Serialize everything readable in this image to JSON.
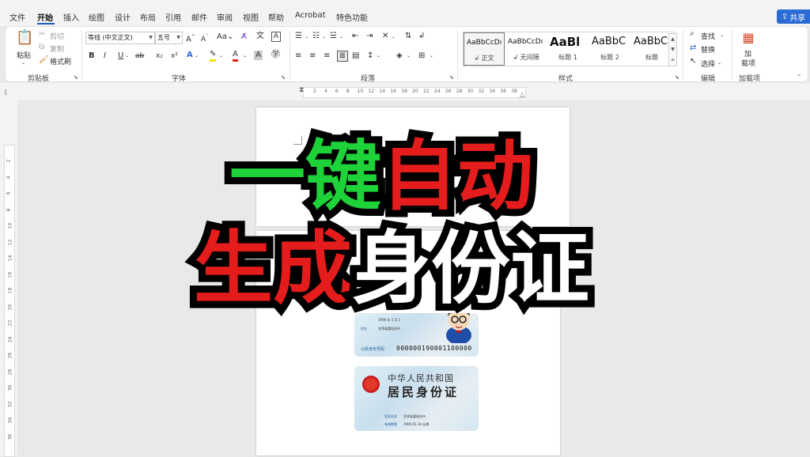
{
  "menu": {
    "tabs": [
      "文件",
      "开始",
      "插入",
      "绘图",
      "设计",
      "布局",
      "引用",
      "邮件",
      "审阅",
      "视图",
      "帮助",
      "Acrobat",
      "特色功能"
    ],
    "active_tab": "开始",
    "share_label": "共享"
  },
  "ribbon": {
    "clipboard": {
      "paste_label": "粘贴",
      "cut_label": "剪切",
      "copy_label": "复制",
      "format_painter_label": "格式刷",
      "group_label": "剪贴板"
    },
    "font": {
      "font_name": "等线 (中文正文)",
      "font_size": "五号",
      "group_label": "字体",
      "bold": "B",
      "italic": "I",
      "underline": "U",
      "strike": "ab",
      "subscript": "x₂",
      "superscript": "x²",
      "change_case": "Aa",
      "grow_font": "A",
      "shrink_font": "A"
    },
    "paragraph": {
      "group_label": "段落"
    },
    "styles": {
      "group_label": "样式",
      "items": [
        {
          "sample": "AaBbCcDı",
          "name": "正文"
        },
        {
          "sample": "AaBbCcDı",
          "name": "无间隔"
        },
        {
          "sample": "AaBl",
          "name": "标题 1"
        },
        {
          "sample": "AaBbC",
          "name": "标题 2"
        },
        {
          "sample": "AaBbC",
          "name": "标题"
        }
      ]
    },
    "editing": {
      "group_label": "编辑",
      "find_label": "查找",
      "replace_label": "替换",
      "select_label": "选择"
    },
    "addins": {
      "group_label": "加载项",
      "button_label_line1": "加",
      "button_label_line2": "载项"
    }
  },
  "ruler": {
    "horizontal": [
      "2",
      "4",
      "6",
      "8",
      "10",
      "12",
      "14",
      "16",
      "18",
      "20",
      "22",
      "24",
      "26",
      "28",
      "30",
      "32",
      "34",
      "36",
      "38"
    ],
    "vertical": [
      "2",
      "4",
      "6",
      "8",
      "10",
      "12",
      "14",
      "16",
      "18",
      "20",
      "22",
      "24",
      "26",
      "28",
      "30",
      "32",
      "34",
      "36"
    ]
  },
  "banner": {
    "line1": [
      {
        "text": "一键",
        "color": "green"
      },
      {
        "text": "自动",
        "color": "red"
      }
    ],
    "line2": [
      {
        "text": "生成",
        "color": "red"
      },
      {
        "text": "身份证",
        "color": "white"
      }
    ]
  },
  "id_card_front": {
    "birth": "1900 年 1 月 1",
    "address_label": "住址",
    "address": "甘肃省嘉峪关市",
    "id_number_label": "公民身份号码",
    "id_number": "000000190001100000"
  },
  "id_card_back": {
    "country": "中华人民共和国",
    "title": "居民身份证",
    "authority_label": "签发机关",
    "authority": "甘肃省嘉峪关市",
    "validity_label": "有效期限",
    "validity": "1900.01.10-长期"
  },
  "colors": {
    "accent": "#185abd",
    "banner_green": "#1ed33a",
    "banner_red": "#e41c1c",
    "banner_white": "#ffffff",
    "banner_outline": "#000000"
  }
}
